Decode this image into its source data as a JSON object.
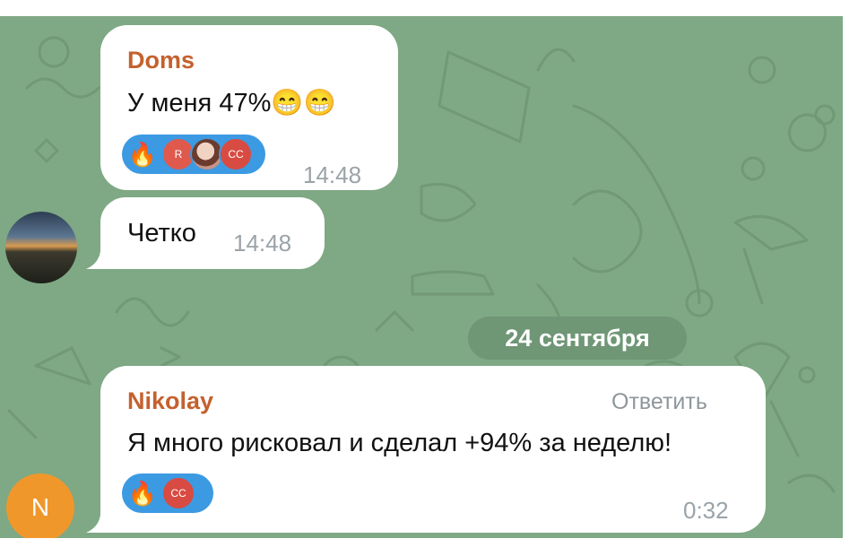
{
  "messages": [
    {
      "sender": "Doms",
      "text": "У меня 47%😁😁",
      "time": "14:48",
      "reactions": {
        "emoji": "🔥",
        "avatars": [
          "R",
          "",
          "CC"
        ]
      }
    },
    {
      "text": "Четко",
      "time": "14:48"
    },
    {
      "sender": "Nikolay",
      "reply_label": "Ответить",
      "text": "Я много рисковал и сделал +94% за неделю!",
      "time": "0:32",
      "reactions": {
        "emoji": "🔥",
        "avatars": [
          "CC"
        ]
      },
      "avatar_initial": "N"
    }
  ],
  "date_separator": "24 сентября",
  "colors": {
    "chat_background": "#7fa884",
    "sender_name": "#c4612e",
    "reaction_pill": "#3c9ae3",
    "avatar_n": "#f0972c"
  }
}
